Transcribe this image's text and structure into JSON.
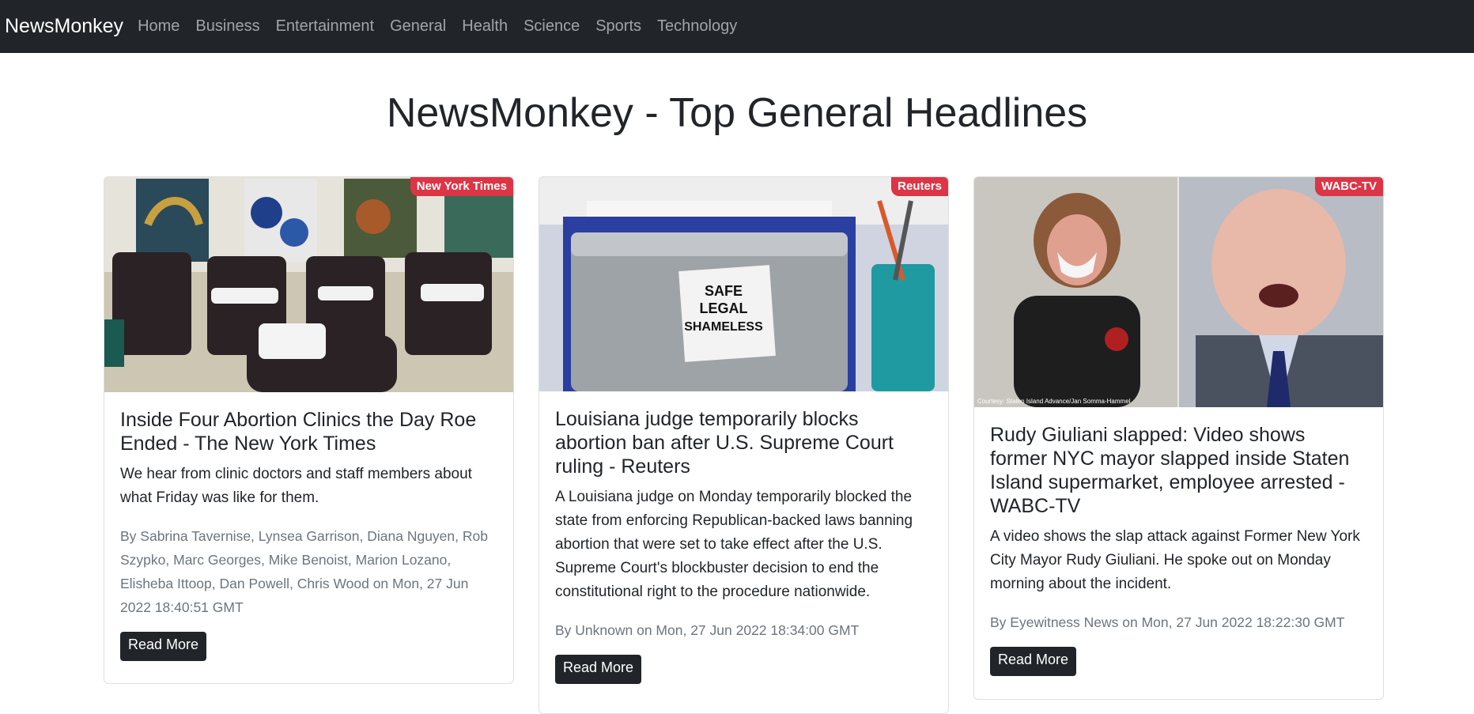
{
  "nav": {
    "brand": "NewsMonkey",
    "links": [
      "Home",
      "Business",
      "Entertainment",
      "General",
      "Health",
      "Science",
      "Sports",
      "Technology"
    ]
  },
  "page": {
    "title": "NewsMonkey - Top General Headlines"
  },
  "articles": [
    {
      "source": "New York Times",
      "title": "Inside Four Abortion Clinics the Day Roe Ended - The New York Times",
      "description": "We hear from clinic doctors and staff members about what Friday was like for them.",
      "meta": "By Sabrina Tavernise, Lynsea Garrison, Diana Nguyen, Rob Szypko, Marc Georges, Mike Benoist, Marion Lozano, Elisheba Ittoop, Dan Powell, Chris Wood on Mon, 27 Jun 2022 18:40:51 GMT",
      "button": "Read More"
    },
    {
      "source": "Reuters",
      "title": "Louisiana judge temporarily blocks abortion ban after U.S. Supreme Court ruling - Reuters",
      "description": "A Louisiana judge on Monday temporarily blocked the state from enforcing Republican-backed laws banning abortion that were set to take effect after the U.S. Supreme Court's blockbuster decision to end the constitutional right to the procedure nationwide.",
      "meta": "By Unknown on Mon, 27 Jun 2022 18:34:00 GMT",
      "button": "Read More",
      "image_sticker": [
        "SAFE",
        "LEGAL",
        "SHAMELESS"
      ]
    },
    {
      "source": "WABC-TV",
      "title": "Rudy Giuliani slapped: Video shows former NYC mayor slapped inside Staten Island supermarket, employee arrested - WABC-TV",
      "description": "A video shows the slap attack against Former New York City Mayor Rudy Giuliani. He spoke out on Monday morning about the incident.",
      "meta": "By Eyewitness News on Mon, 27 Jun 2022 18:22:30 GMT",
      "button": "Read More",
      "image_caption": "Courtesy: Staten Island Advance/Jan Somma-Hammel"
    }
  ],
  "colors": {
    "navbar": "#212529",
    "badge": "#dc3545",
    "button": "#212529",
    "muted_text": "#6c757d"
  }
}
